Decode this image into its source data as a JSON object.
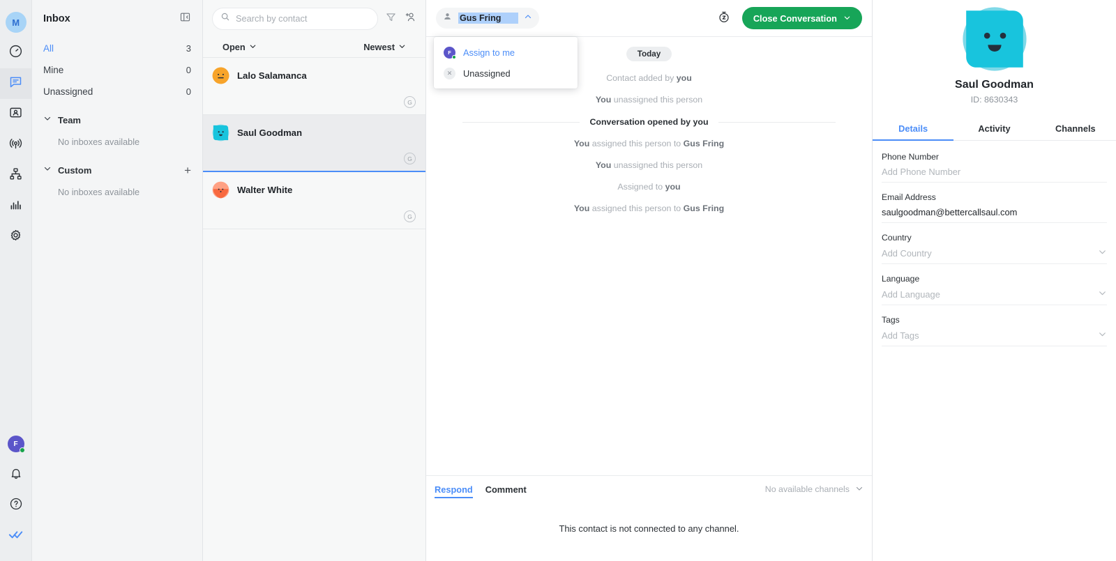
{
  "rail": {
    "logo": "M",
    "items": [
      {
        "name": "workspace-logo",
        "label": "M"
      },
      {
        "name": "dashboard-icon",
        "label": "Dashboard"
      },
      {
        "name": "conversations-icon",
        "label": "Conversations"
      },
      {
        "name": "contacts-icon",
        "label": "Contacts"
      },
      {
        "name": "broadcast-icon",
        "label": "Broadcast"
      },
      {
        "name": "workflows-icon",
        "label": "Workflows"
      },
      {
        "name": "analytics-icon",
        "label": "Analytics"
      },
      {
        "name": "settings-icon",
        "label": "Settings"
      }
    ],
    "user_initial": "F",
    "bottom": [
      {
        "name": "notifications-icon",
        "label": "Notifications"
      },
      {
        "name": "help-icon",
        "label": "Help"
      },
      {
        "name": "read-all-icon",
        "label": "Mark all read"
      }
    ]
  },
  "inbox": {
    "title": "Inbox",
    "collapse_icon": "panel-collapse-icon",
    "rows": [
      {
        "label": "All",
        "count": "3",
        "active": true
      },
      {
        "label": "Mine",
        "count": "0",
        "active": false
      },
      {
        "label": "Unassigned",
        "count": "0",
        "active": false
      }
    ],
    "groups": [
      {
        "title": "Team",
        "empty": "No inboxes available",
        "add": false
      },
      {
        "title": "Custom",
        "empty": "No inboxes available",
        "add": true,
        "add_label": "+"
      }
    ]
  },
  "convlist": {
    "search": {
      "placeholder": "Search by contact",
      "value": ""
    },
    "filter_icon": "filter-funnel-icon",
    "add_contact_icon": "add-contact-icon",
    "status_filter": "Open",
    "sort_filter": "Newest",
    "conversations": [
      {
        "name": "Lalo Salamanca",
        "badge": "G",
        "avatar": "orange-circle-face",
        "selected": false
      },
      {
        "name": "Saul Goodman",
        "badge": "G",
        "avatar": "cyan-square-face",
        "selected": true
      },
      {
        "name": "Walter White",
        "badge": "G",
        "avatar": "red-shield-face",
        "selected": false
      }
    ]
  },
  "conversation": {
    "assignee": "Gus Fring",
    "assign_icon": "person-icon",
    "chevron_icon": "chevron-up-icon",
    "snooze_icon": "snooze-timer-icon",
    "close_button": "Close Conversation",
    "close_chevron_icon": "chevron-down-icon",
    "assign_menu": [
      {
        "label": "Assign to me",
        "icon": "user-avatar-f",
        "accent": true
      },
      {
        "label": "Unassigned",
        "icon": "close-circle-icon",
        "accent": false
      }
    ],
    "day_chip": "Today",
    "events": [
      {
        "type": "sys",
        "pre": "Contact added by ",
        "bold": "you",
        "post": ""
      },
      {
        "type": "sys",
        "pre": "",
        "bold": "You",
        "post": " unassigned this person"
      },
      {
        "type": "rule",
        "text": "Conversation opened by you"
      },
      {
        "type": "sys",
        "pre": "",
        "bold": "You",
        "post": " assigned this person to ",
        "bold2": "Gus Fring"
      },
      {
        "type": "sys",
        "pre": "",
        "bold": "You",
        "post": " unassigned this person"
      },
      {
        "type": "sys",
        "pre": "Assigned to ",
        "bold": "you",
        "post": ""
      },
      {
        "type": "sys",
        "pre": "",
        "bold": "You",
        "post": " assigned this person to ",
        "bold2": "Gus Fring"
      }
    ],
    "composer": {
      "tabs": [
        {
          "label": "Respond",
          "active": true
        },
        {
          "label": "Comment",
          "active": false
        }
      ],
      "channel_text": "No available channels",
      "channel_chevron_icon": "chevron-down-icon",
      "empty_text": "This contact is not connected to any channel."
    }
  },
  "details": {
    "avatar": "cyan-square-face",
    "name": "Saul Goodman",
    "id": "ID: 8630343",
    "tabs": [
      {
        "label": "Details",
        "active": true
      },
      {
        "label": "Activity",
        "active": false
      },
      {
        "label": "Channels",
        "active": false
      }
    ],
    "fields": [
      {
        "label": "Phone Number",
        "value": "Add Phone Number",
        "placeholder": true,
        "chevron": false
      },
      {
        "label": "Email Address",
        "value": "saulgoodman@bettercallsaul.com",
        "placeholder": false,
        "chevron": false
      },
      {
        "label": "Country",
        "value": "Add Country",
        "placeholder": true,
        "chevron": true
      },
      {
        "label": "Language",
        "value": "Add Language",
        "placeholder": true,
        "chevron": true
      },
      {
        "label": "Tags",
        "value": "Add Tags",
        "placeholder": true,
        "chevron": true
      }
    ]
  },
  "colors": {
    "accent_blue": "#4b8df8",
    "close_green": "#17a558",
    "avatar_purple": "#5b55c9",
    "status_green": "#16a34a",
    "selection_blue": "#aed0fb"
  }
}
